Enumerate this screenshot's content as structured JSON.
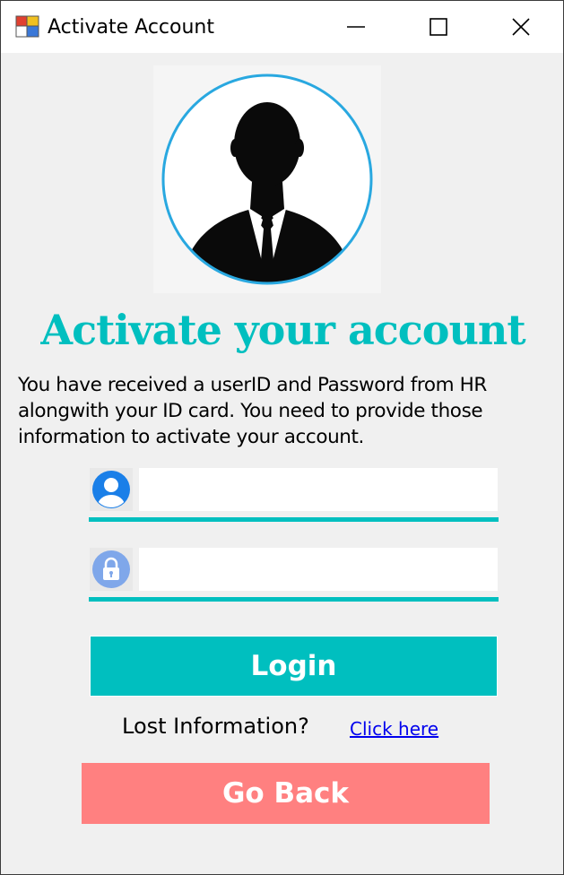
{
  "window": {
    "title": "Activate Account",
    "controls": {
      "minimize": "minimize-icon",
      "maximize": "maximize-icon",
      "close": "close-icon"
    }
  },
  "avatar": {
    "icon": "user-silhouette-icon",
    "ring_color": "#29a8e0"
  },
  "heading": "Activate your account",
  "description": "You have received a userID and Password from HR alongwith your ID card. You need to provide those information to activate your account.",
  "fields": {
    "userid": {
      "icon": "user-icon",
      "value": "",
      "placeholder": ""
    },
    "password": {
      "icon": "lock-icon",
      "value": "",
      "placeholder": ""
    }
  },
  "buttons": {
    "login": "Login",
    "go_back": "Go Back"
  },
  "lost_info": {
    "text": "Lost Information?",
    "link": "Click here"
  },
  "colors": {
    "accent": "#00bfbf",
    "back_button": "#ff8080",
    "link": "#0000ee",
    "background": "#f0f0f0"
  }
}
